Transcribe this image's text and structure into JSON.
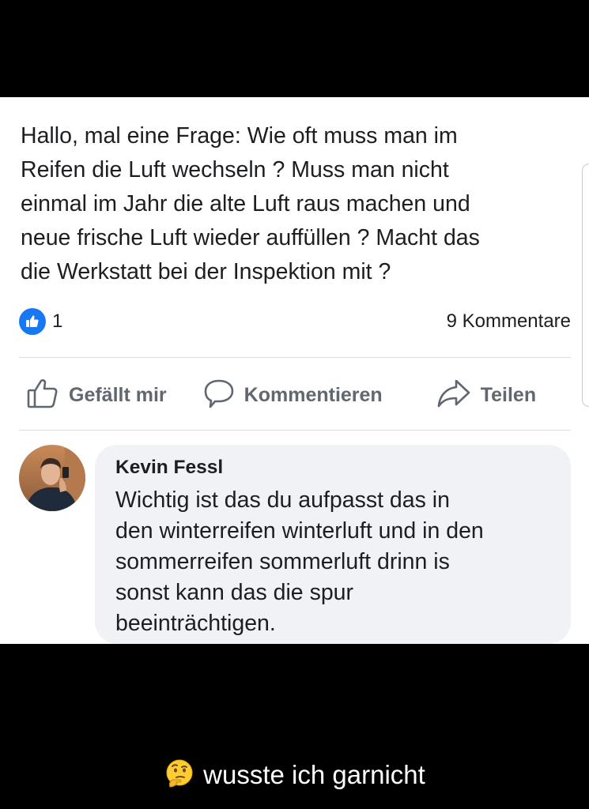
{
  "post": {
    "text": "Hallo, mal eine Frage: Wie oft muss man im\nReifen die Luft wechseln ? Muss man nicht\neinmal im Jahr die alte Luft raus machen und\nneue frische Luft wieder auffüllen ? Macht das\ndie Werkstatt bei der Inspektion mit ?",
    "likes": "1",
    "comments": "9 Kommentare"
  },
  "actions": {
    "like_label": "Gefällt mir",
    "comment_label": "Kommentieren",
    "share_label": "Teilen"
  },
  "comment": {
    "author": "Kevin Fessl",
    "text": "Wichtig ist das du aufpasst das in\nden winterreifen winterluft und in den\nsommerreifen sommerluft drinn is\nsonst kann das die spur\nbeeinträchtigen."
  },
  "caption": {
    "emoji": "thinking-face-icon",
    "text": "wusste ich garnicht"
  },
  "colors": {
    "like_blue": "#1877f2",
    "action_grey": "#606770",
    "bubble_bg": "#f0f2f5",
    "text": "#1c1e21"
  }
}
